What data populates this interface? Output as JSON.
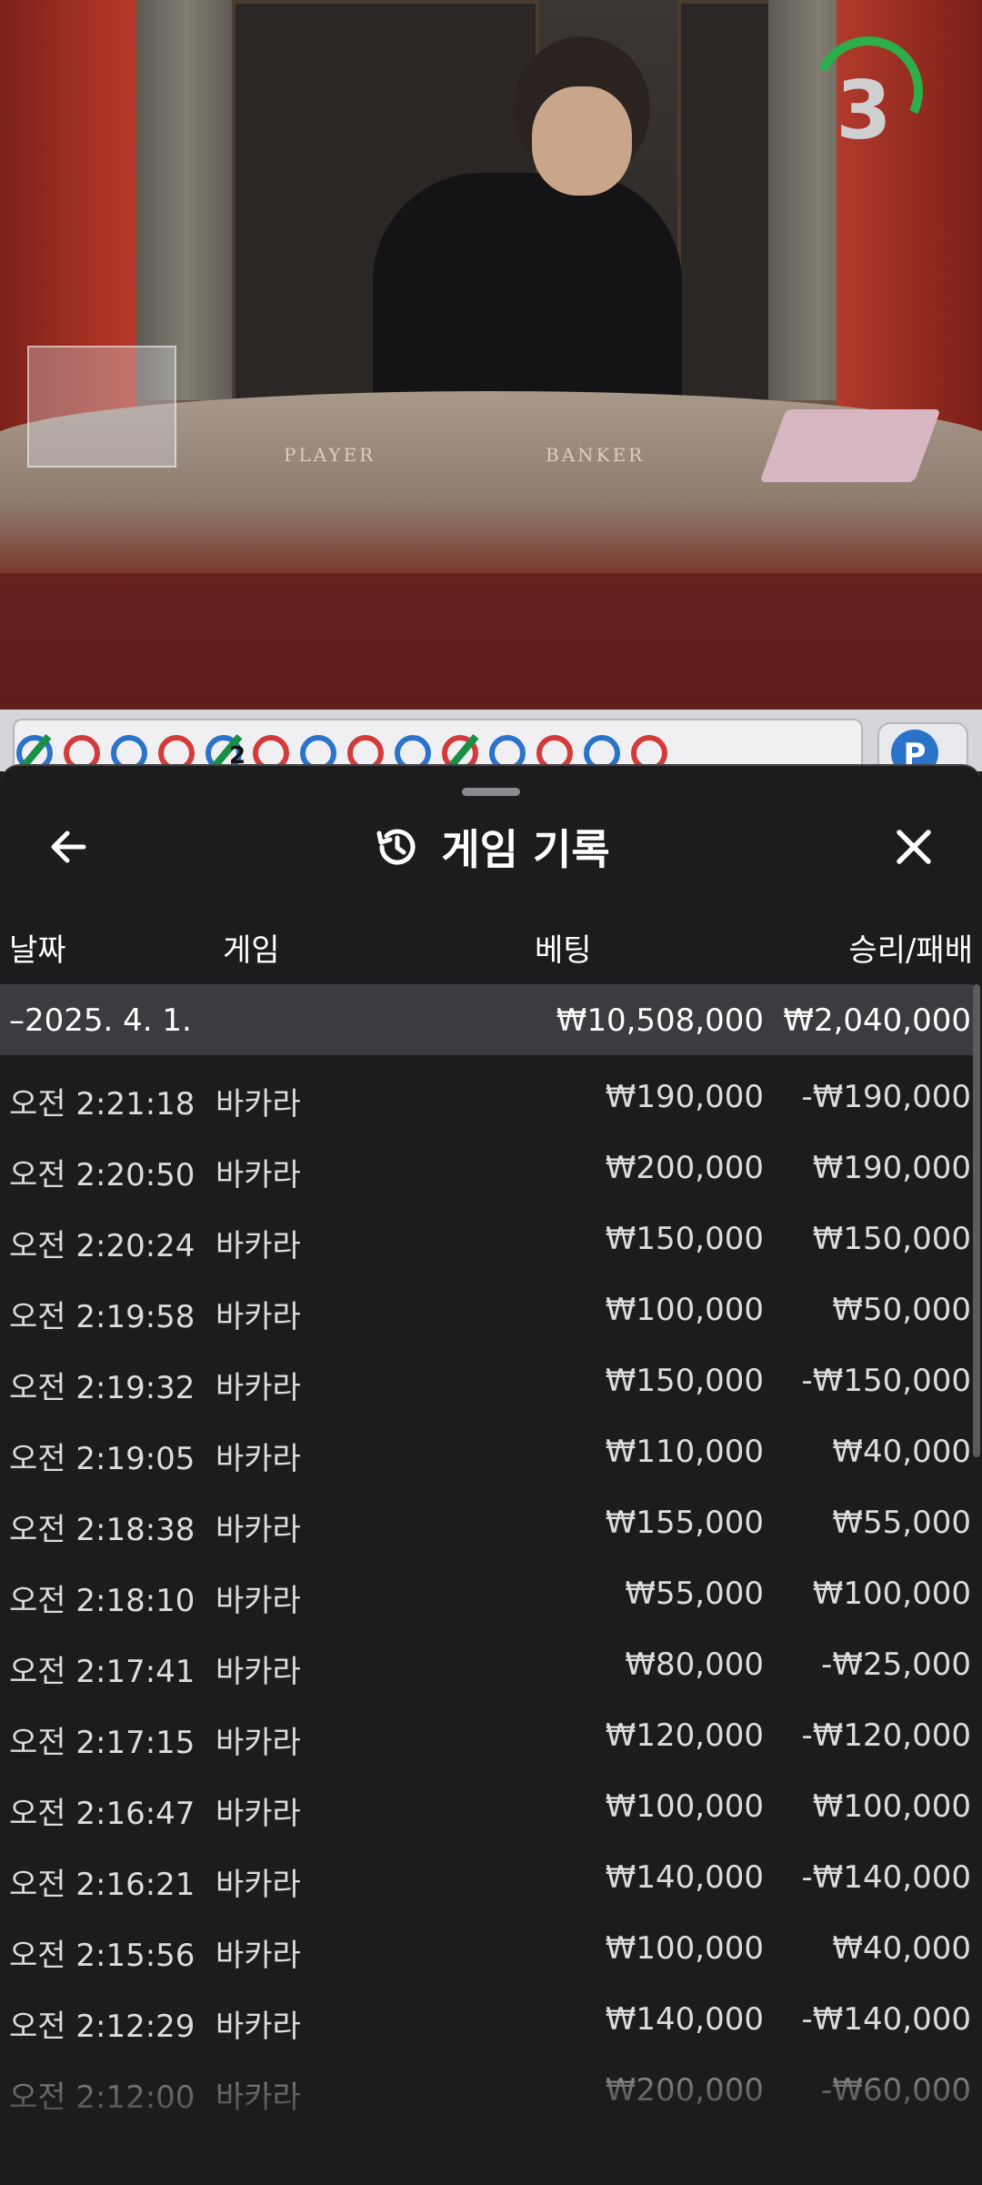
{
  "stream": {
    "countdown": "3",
    "table_labels": {
      "player": "PLAYER",
      "banker": "BANKER"
    }
  },
  "road": {
    "bead_number": "2",
    "round_button_letter": "P",
    "colors": {
      "red": "#d33b3b",
      "blue": "#2b73c9",
      "tie_green": "#1a8f46"
    }
  },
  "sheet": {
    "title": "게임 기록",
    "icons": {
      "back": "arrow-left-icon",
      "history": "history-icon",
      "close": "close-icon"
    },
    "columns": {
      "date": "날짜",
      "game": "게임",
      "bet": "베팅",
      "win_loss": "승리/패배"
    },
    "summary": {
      "date": "–2025. 4. 1.",
      "bet": "₩10,508,000",
      "win_loss": "₩2,040,000"
    },
    "rows": [
      {
        "time": "오전 2:21:18",
        "game": "바카라",
        "bet": "₩190,000",
        "win_loss": "-₩190,000"
      },
      {
        "time": "오전 2:20:50",
        "game": "바카라",
        "bet": "₩200,000",
        "win_loss": "₩190,000"
      },
      {
        "time": "오전 2:20:24",
        "game": "바카라",
        "bet": "₩150,000",
        "win_loss": "₩150,000"
      },
      {
        "time": "오전 2:19:58",
        "game": "바카라",
        "bet": "₩100,000",
        "win_loss": "₩50,000"
      },
      {
        "time": "오전 2:19:32",
        "game": "바카라",
        "bet": "₩150,000",
        "win_loss": "-₩150,000"
      },
      {
        "time": "오전 2:19:05",
        "game": "바카라",
        "bet": "₩110,000",
        "win_loss": "₩40,000"
      },
      {
        "time": "오전 2:18:38",
        "game": "바카라",
        "bet": "₩155,000",
        "win_loss": "₩55,000"
      },
      {
        "time": "오전 2:18:10",
        "game": "바카라",
        "bet": "₩55,000",
        "win_loss": "₩100,000"
      },
      {
        "time": "오전 2:17:41",
        "game": "바카라",
        "bet": "₩80,000",
        "win_loss": "-₩25,000"
      },
      {
        "time": "오전 2:17:15",
        "game": "바카라",
        "bet": "₩120,000",
        "win_loss": "-₩120,000"
      },
      {
        "time": "오전 2:16:47",
        "game": "바카라",
        "bet": "₩100,000",
        "win_loss": "₩100,000"
      },
      {
        "time": "오전 2:16:21",
        "game": "바카라",
        "bet": "₩140,000",
        "win_loss": "-₩140,000"
      },
      {
        "time": "오전 2:15:56",
        "game": "바카라",
        "bet": "₩100,000",
        "win_loss": "₩40,000"
      },
      {
        "time": "오전 2:12:29",
        "game": "바카라",
        "bet": "₩140,000",
        "win_loss": "-₩140,000"
      },
      {
        "time": "오전 2:12:00",
        "game": "바카라",
        "bet": "₩200,000",
        "win_loss": "-₩60,000"
      }
    ]
  }
}
